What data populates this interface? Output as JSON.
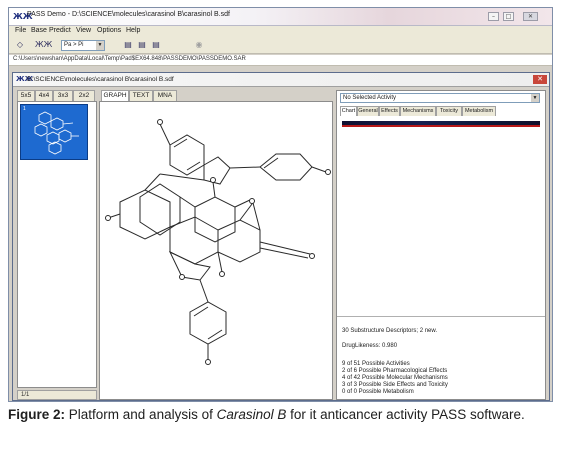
{
  "app": {
    "title": "PASS Demo - D:\\SCIENCE\\molecules\\carasinol B\\carasinol B.sdf",
    "icon_name": "pass-app-icon",
    "window_controls": [
      "minimize-icon",
      "maximize-icon",
      "close-icon"
    ]
  },
  "menu": {
    "items": [
      "File",
      "Base",
      "Predict",
      "View",
      "Options",
      "Help"
    ]
  },
  "toolbar": {
    "pa_select_value": "Pa > Pi"
  },
  "path_bar": {
    "text": "C:\\Users\\newshan\\AppData\\Local\\Temp\\Pad$EX64.848\\PASSDEMO\\PASSDEMO.SAR"
  },
  "child_window": {
    "title": "D:\\SCIENCE\\molecules\\carasinol B\\carasinol B.sdf",
    "left_tabs": [
      "5x5",
      "4x4",
      "3x3",
      "2x2",
      "GRAPH",
      "TEXT",
      "MNA"
    ],
    "thumbnail_index": "1",
    "status_left": "1/1"
  },
  "right_panel": {
    "activity_select_value": "No Selected Activity",
    "tabs": [
      "Chart",
      "General",
      "Effects",
      "Mechanisms",
      "Toxicity",
      "Metabolism"
    ],
    "descriptors": "30 Substructure Descriptors; 2 new.",
    "druglikeness": "DrugLikeness:  0.980",
    "summary": [
      "9 of 51 Possible Activities",
      "2 of 6 Possible Pharmacological Effects",
      "4 of 42 Possible Molecular Mechanisms",
      "3 of 3 Possible Side Effects and Toxicity",
      "0 of 0 Possible Metabolism"
    ],
    "colors": {
      "strip": "#182050",
      "accent": "#b81818"
    }
  },
  "caption": {
    "label": "Figure 2:",
    "before": " Platform and analysis of ",
    "compound": "Carasinol B",
    "after": " for it anticancer activity PASS software."
  }
}
